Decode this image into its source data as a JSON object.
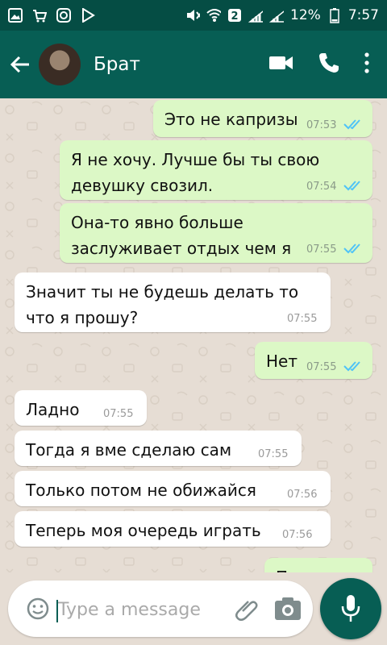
{
  "status_bar": {
    "battery_percent_text": "12%",
    "time_text": "7:57",
    "icons": [
      "gallery-icon",
      "shop-icon",
      "instagram-icon",
      "play-store-icon",
      "mute-icon",
      "wifi-icon",
      "sim2-icon",
      "signal-icon",
      "signal-icon",
      "battery-icon"
    ]
  },
  "header": {
    "contact_name": "Брат",
    "icons": [
      "back-arrow-icon",
      "video-call-icon",
      "phone-icon",
      "more-vertical-icon"
    ]
  },
  "messages": [
    {
      "dir": "out",
      "text": "Это не капризы",
      "time": "07:53",
      "read": true
    },
    {
      "dir": "out",
      "text": "Я не хочу. Лучше бы ты свою\nдевушку свозил.",
      "time": "07:54",
      "read": true
    },
    {
      "dir": "out",
      "text": "Она-то явно больше\nзаслуживает отдых чем я",
      "time": "07:55",
      "read": true
    },
    {
      "dir": "in",
      "text": "Значит ты не будешь делать то\nчто я прошу?",
      "time": "07:55"
    },
    {
      "dir": "out",
      "text": "Нет",
      "time": "07:55",
      "read": true
    },
    {
      "dir": "in",
      "text": "Ладно",
      "time": "07:55"
    },
    {
      "dir": "in",
      "text": "Тогда я вме сделаю сам",
      "time": "07:55"
    },
    {
      "dir": "in",
      "text": "Только потом не обижайся",
      "time": "07:56"
    },
    {
      "dir": "in",
      "text": "Теперь моя очередь играть",
      "time": "07:56"
    },
    {
      "dir": "out",
      "text": "П",
      "time": ""
    }
  ],
  "composer": {
    "placeholder": "Type a message",
    "icons": [
      "emoji-icon",
      "attach-icon",
      "camera-icon",
      "mic-icon"
    ]
  },
  "colors": {
    "header": "#075e54",
    "status_bar": "#054d44",
    "outgoing_bubble": "#dcf8c6",
    "incoming_bubble": "#ffffff",
    "read_ticks": "#4fc3f7"
  }
}
